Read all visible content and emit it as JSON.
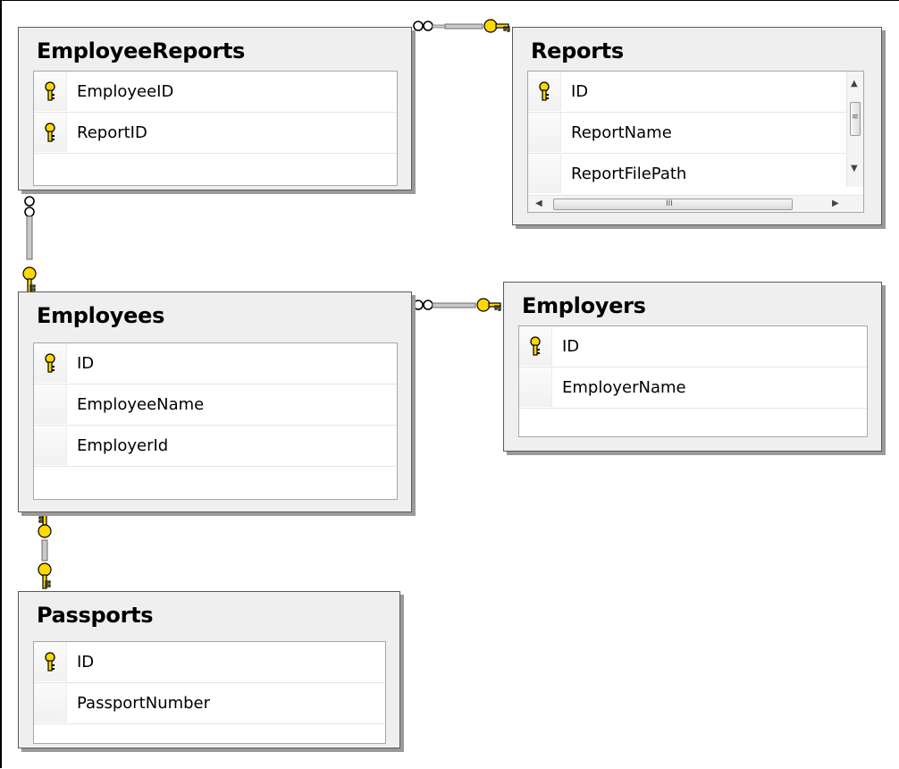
{
  "tables": {
    "employee_reports": {
      "title": "EmployeeReports",
      "columns": [
        {
          "name": "EmployeeID",
          "key": true
        },
        {
          "name": "ReportID",
          "key": true
        }
      ]
    },
    "reports": {
      "title": "Reports",
      "columns": [
        {
          "name": "ID",
          "key": true
        },
        {
          "name": "ReportName",
          "key": false
        },
        {
          "name": "ReportFilePath",
          "key": false
        }
      ],
      "scroll_grip": "III"
    },
    "employees": {
      "title": "Employees",
      "columns": [
        {
          "name": "ID",
          "key": true
        },
        {
          "name": "EmployeeName",
          "key": false
        },
        {
          "name": "EmployerId",
          "key": false
        }
      ]
    },
    "employers": {
      "title": "Employers",
      "columns": [
        {
          "name": "ID",
          "key": true
        },
        {
          "name": "EmployerName",
          "key": false
        }
      ]
    },
    "passports": {
      "title": "Passports",
      "columns": [
        {
          "name": "ID",
          "key": true
        },
        {
          "name": "PassportNumber",
          "key": false
        }
      ]
    }
  },
  "relationships": [
    {
      "from": "employee_reports",
      "to": "reports",
      "from_end": "many",
      "to_end": "one"
    },
    {
      "from": "employee_reports",
      "to": "employees",
      "from_end": "many",
      "to_end": "one"
    },
    {
      "from": "employees",
      "to": "employers",
      "from_end": "many",
      "to_end": "one"
    },
    {
      "from": "employees",
      "to": "passports",
      "from_end": "one",
      "to_end": "one"
    }
  ],
  "colors": {
    "key_yellow": "#ffd800",
    "connector_gray": "#bdbdbd",
    "box_background": "#efefef"
  }
}
